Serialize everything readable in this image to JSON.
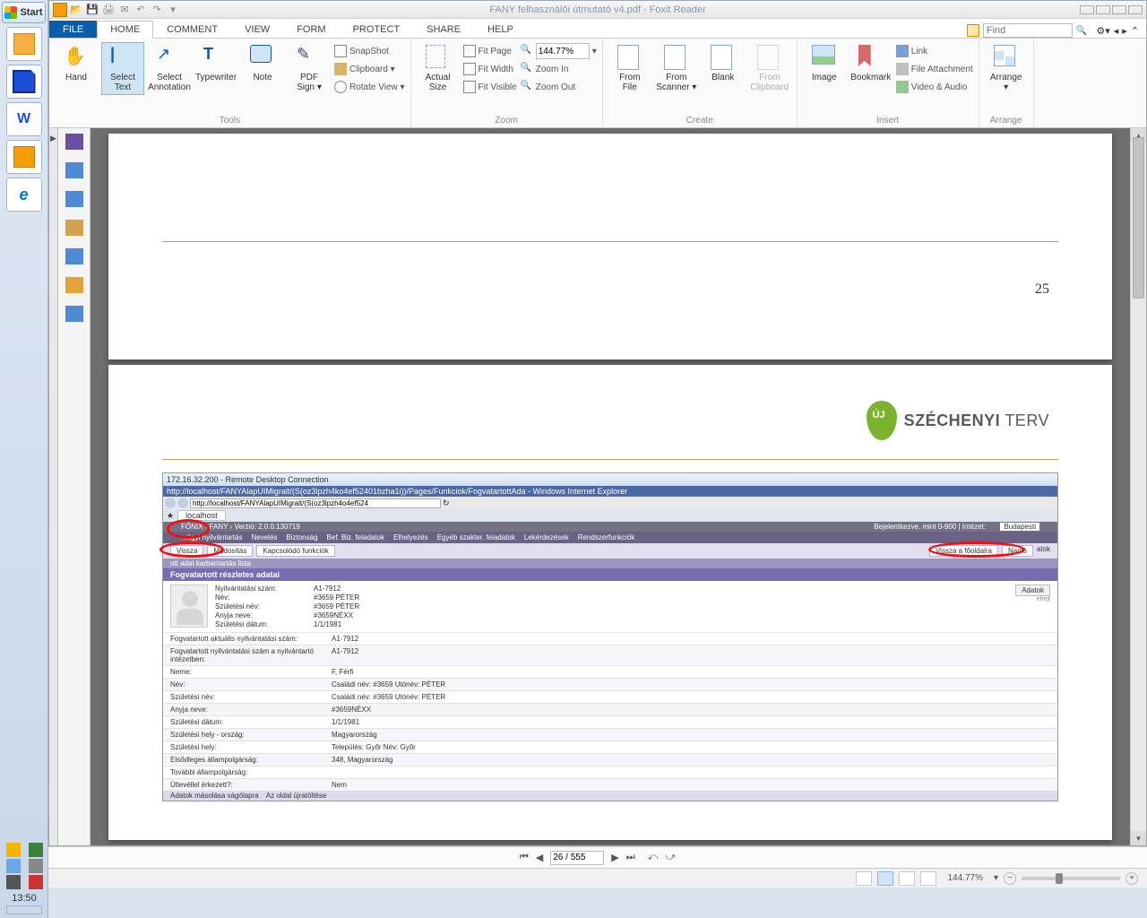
{
  "windows": {
    "start_label": "Start",
    "clock": "13:50"
  },
  "app": {
    "title": "FANY felhasználói útmutató v4.pdf - Foxit Reader",
    "tabs": {
      "file": "FILE",
      "home": "HOME",
      "comment": "COMMENT",
      "view": "VIEW",
      "form": "FORM",
      "protect": "PROTECT",
      "share": "SHARE",
      "help": "HELP"
    },
    "find_placeholder": "Find",
    "ribbon": {
      "tools": {
        "hand": "Hand",
        "select_text": "Select\nText",
        "select_annotation": "Select\nAnnotation",
        "typewriter": "Typewriter",
        "note": "Note",
        "pdf_sign": "PDF\nSign ▾",
        "snapshot": "SnapShot",
        "clipboard": "Clipboard ▾",
        "rotate_view": "Rotate View ▾",
        "group": "Tools"
      },
      "zoom": {
        "actual_size": "Actual\nSize",
        "fit_page": "Fit Page",
        "fit_width": "Fit Width",
        "fit_visible": "Fit Visible",
        "zoom_value": "144.77%",
        "zoom_in": "Zoom In",
        "zoom_out": "Zoom Out",
        "group": "Zoom"
      },
      "create": {
        "from_file": "From\nFile",
        "from_scanner": "From\nScanner ▾",
        "blank": "Blank",
        "from_clipboard": "From\nClipboard",
        "group": "Create"
      },
      "insert": {
        "image": "Image",
        "bookmark": "Bookmark",
        "link": "Link",
        "file_attachment": "File Attachment",
        "video_audio": "Video & Audio",
        "group": "Insert"
      },
      "arrange": {
        "arrange": "Arrange\n▾",
        "group": "Arrange"
      }
    }
  },
  "page1": {
    "number": "25"
  },
  "page2": {
    "logo_small": "ÚJ",
    "logo_bold": "SZÉCHENYI",
    "logo_rest": " TERV"
  },
  "embed": {
    "rd_title": "172.16.32.200 - Remote Desktop Connection",
    "ie_title": "http://localhost/FANYAlapUIMigralt/(S(oz3lpzh4ko4ef52401bzha1i))/Pages/Funkciok/FogvatartottAda - Windows Internet Explorer",
    "ie_url": "http://localhost/FANYAlapUIMigralt/(S(oz3lpzh4o4ef524",
    "ie_tab": "localhost",
    "breadcrumb": "FŐNIX  ›  FANY  ›  Verzió: 2.0.0.130719",
    "login_info": "Bejelentkezve, mint 0-900 | Intézet:",
    "login_inst": "Budapesti",
    "nav": [
      "...ügyi nyilvántartás",
      "Nevelés",
      "Biztonság",
      "Bef. Biz. feladatok",
      "Elhelyezés",
      "Egyéb szakter. feladatok",
      "Lekérdezések",
      "Rendszerfunkciók"
    ],
    "sub_left": [
      "Vissza",
      "Módosítás",
      "Kapcsolódó funkciók"
    ],
    "sub_right": [
      "Vissza a főoldalra",
      "Napló"
    ],
    "sub_right_trail": "atok",
    "head2": "ott adat karbantartás lista",
    "head3": "Fogvatartott részletes adatai",
    "top_kv": [
      [
        "Nyilvántatási szám:",
        "A1-7912"
      ],
      [
        "Név:",
        "#3659  PÉTER"
      ],
      [
        "Születési név:",
        "#3659  PÉTER"
      ],
      [
        "Anyja neve:",
        "#3659NÉXX"
      ],
      [
        "Születési dátum:",
        "1/1/1981"
      ]
    ],
    "adatok_btn": "Adatok",
    "adatok_small": "elrejt",
    "rows": [
      [
        "Fogvatartott aktuális nyilvántatási szám:",
        "A1-7912"
      ],
      [
        "Fogvatartott nyilvántatási szám a nyilvántartó intézetben:",
        "A1-7912"
      ],
      [
        "Neme:",
        "F, Férfi"
      ],
      [
        "Név:",
        "Családi név:  #3659     Utónév:   PÉTER"
      ],
      [
        "Születési név:",
        "Családi név:  #3659     Utónév:   PÉTER"
      ],
      [
        "Anyja neve:",
        "#3659NÉXX"
      ],
      [
        "Születési dátum:",
        "1/1/1981"
      ],
      [
        "Születési hely - ország:",
        "Magyarország"
      ],
      [
        "Születési hely:",
        "Település:  Győr   Név:  Győr"
      ],
      [
        "Elsődleges állampolgárság:",
        "348, Magyarország"
      ],
      [
        "További állampolgárság:",
        ""
      ],
      [
        "Útlevéllel érkezett?:",
        "Nem"
      ]
    ],
    "foot": [
      "Adatok másolása vágólapra",
      "Az oldal újratöltése"
    ]
  },
  "navbar": {
    "page_field": "26 / 555"
  },
  "status": {
    "zoom": "144.77%"
  }
}
